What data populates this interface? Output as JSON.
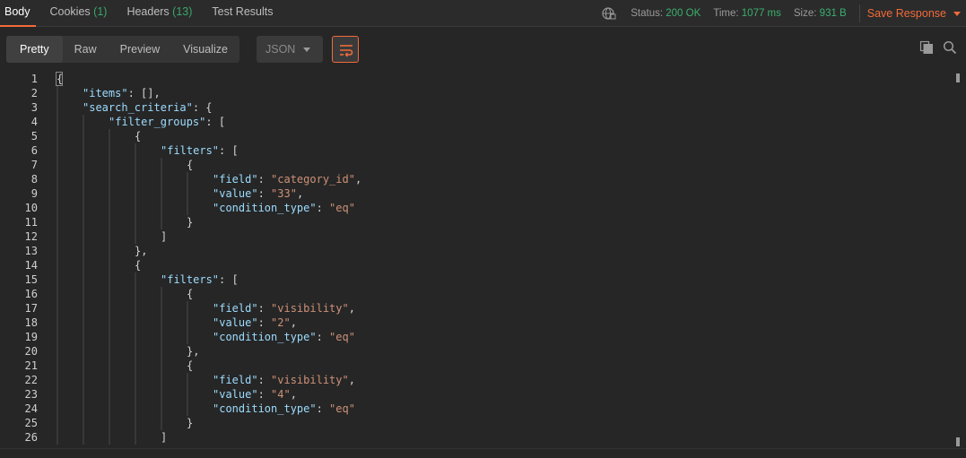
{
  "tabs": [
    {
      "label": "Body",
      "count": "",
      "active": true
    },
    {
      "label": "Cookies",
      "count": "(1)",
      "active": false
    },
    {
      "label": "Headers",
      "count": "(13)",
      "active": false
    },
    {
      "label": "Test Results",
      "count": "",
      "active": false
    }
  ],
  "status": {
    "status_label": "Status:",
    "status_value": "200 OK",
    "time_label": "Time:",
    "time_value": "1077 ms",
    "size_label": "Size:",
    "size_value": "931 B"
  },
  "save_response_label": "Save Response",
  "views": [
    {
      "label": "Pretty",
      "active": true
    },
    {
      "label": "Raw",
      "active": false
    },
    {
      "label": "Preview",
      "active": false
    },
    {
      "label": "Visualize",
      "active": false
    }
  ],
  "format_selected": "JSON",
  "icons": {
    "globe": "globe-icon",
    "wrap": "wrap-lines-icon",
    "copy": "copy-icon",
    "search": "search-icon"
  },
  "colors": {
    "accent": "#f26b3a",
    "status_ok": "#3bb06f",
    "key": "#9cdcfe",
    "string": "#ce9178"
  },
  "code_lines": [
    {
      "n": "1",
      "indent": 0,
      "tokens": [
        {
          "t": "{",
          "c": "p"
        }
      ]
    },
    {
      "n": "2",
      "indent": 1,
      "tokens": [
        {
          "t": "\"items\"",
          "c": "k"
        },
        {
          "t": ": [],",
          "c": "p"
        }
      ]
    },
    {
      "n": "3",
      "indent": 1,
      "tokens": [
        {
          "t": "\"search_criteria\"",
          "c": "k"
        },
        {
          "t": ": {",
          "c": "p"
        }
      ]
    },
    {
      "n": "4",
      "indent": 2,
      "tokens": [
        {
          "t": "\"filter_groups\"",
          "c": "k"
        },
        {
          "t": ": [",
          "c": "p"
        }
      ]
    },
    {
      "n": "5",
      "indent": 3,
      "tokens": [
        {
          "t": "{",
          "c": "p"
        }
      ]
    },
    {
      "n": "6",
      "indent": 4,
      "tokens": [
        {
          "t": "\"filters\"",
          "c": "k"
        },
        {
          "t": ": [",
          "c": "p"
        }
      ]
    },
    {
      "n": "7",
      "indent": 5,
      "tokens": [
        {
          "t": "{",
          "c": "p"
        }
      ]
    },
    {
      "n": "8",
      "indent": 6,
      "tokens": [
        {
          "t": "\"field\"",
          "c": "k"
        },
        {
          "t": ": ",
          "c": "p"
        },
        {
          "t": "\"category_id\"",
          "c": "s"
        },
        {
          "t": ",",
          "c": "p"
        }
      ]
    },
    {
      "n": "9",
      "indent": 6,
      "tokens": [
        {
          "t": "\"value\"",
          "c": "k"
        },
        {
          "t": ": ",
          "c": "p"
        },
        {
          "t": "\"33\"",
          "c": "s"
        },
        {
          "t": ",",
          "c": "p"
        }
      ]
    },
    {
      "n": "10",
      "indent": 6,
      "tokens": [
        {
          "t": "\"condition_type\"",
          "c": "k"
        },
        {
          "t": ": ",
          "c": "p"
        },
        {
          "t": "\"eq\"",
          "c": "s"
        }
      ]
    },
    {
      "n": "11",
      "indent": 5,
      "tokens": [
        {
          "t": "}",
          "c": "p"
        }
      ]
    },
    {
      "n": "12",
      "indent": 4,
      "tokens": [
        {
          "t": "]",
          "c": "p"
        }
      ]
    },
    {
      "n": "13",
      "indent": 3,
      "tokens": [
        {
          "t": "},",
          "c": "p"
        }
      ]
    },
    {
      "n": "14",
      "indent": 3,
      "tokens": [
        {
          "t": "{",
          "c": "p"
        }
      ]
    },
    {
      "n": "15",
      "indent": 4,
      "tokens": [
        {
          "t": "\"filters\"",
          "c": "k"
        },
        {
          "t": ": [",
          "c": "p"
        }
      ]
    },
    {
      "n": "16",
      "indent": 5,
      "tokens": [
        {
          "t": "{",
          "c": "p"
        }
      ]
    },
    {
      "n": "17",
      "indent": 6,
      "tokens": [
        {
          "t": "\"field\"",
          "c": "k"
        },
        {
          "t": ": ",
          "c": "p"
        },
        {
          "t": "\"visibility\"",
          "c": "s"
        },
        {
          "t": ",",
          "c": "p"
        }
      ]
    },
    {
      "n": "18",
      "indent": 6,
      "tokens": [
        {
          "t": "\"value\"",
          "c": "k"
        },
        {
          "t": ": ",
          "c": "p"
        },
        {
          "t": "\"2\"",
          "c": "s"
        },
        {
          "t": ",",
          "c": "p"
        }
      ]
    },
    {
      "n": "19",
      "indent": 6,
      "tokens": [
        {
          "t": "\"condition_type\"",
          "c": "k"
        },
        {
          "t": ": ",
          "c": "p"
        },
        {
          "t": "\"eq\"",
          "c": "s"
        }
      ]
    },
    {
      "n": "20",
      "indent": 5,
      "tokens": [
        {
          "t": "},",
          "c": "p"
        }
      ]
    },
    {
      "n": "21",
      "indent": 5,
      "tokens": [
        {
          "t": "{",
          "c": "p"
        }
      ]
    },
    {
      "n": "22",
      "indent": 6,
      "tokens": [
        {
          "t": "\"field\"",
          "c": "k"
        },
        {
          "t": ": ",
          "c": "p"
        },
        {
          "t": "\"visibility\"",
          "c": "s"
        },
        {
          "t": ",",
          "c": "p"
        }
      ]
    },
    {
      "n": "23",
      "indent": 6,
      "tokens": [
        {
          "t": "\"value\"",
          "c": "k"
        },
        {
          "t": ": ",
          "c": "p"
        },
        {
          "t": "\"4\"",
          "c": "s"
        },
        {
          "t": ",",
          "c": "p"
        }
      ]
    },
    {
      "n": "24",
      "indent": 6,
      "tokens": [
        {
          "t": "\"condition_type\"",
          "c": "k"
        },
        {
          "t": ": ",
          "c": "p"
        },
        {
          "t": "\"eq\"",
          "c": "s"
        }
      ]
    },
    {
      "n": "25",
      "indent": 5,
      "tokens": [
        {
          "t": "}",
          "c": "p"
        }
      ]
    },
    {
      "n": "26",
      "indent": 4,
      "tokens": [
        {
          "t": "]",
          "c": "p"
        }
      ]
    }
  ]
}
